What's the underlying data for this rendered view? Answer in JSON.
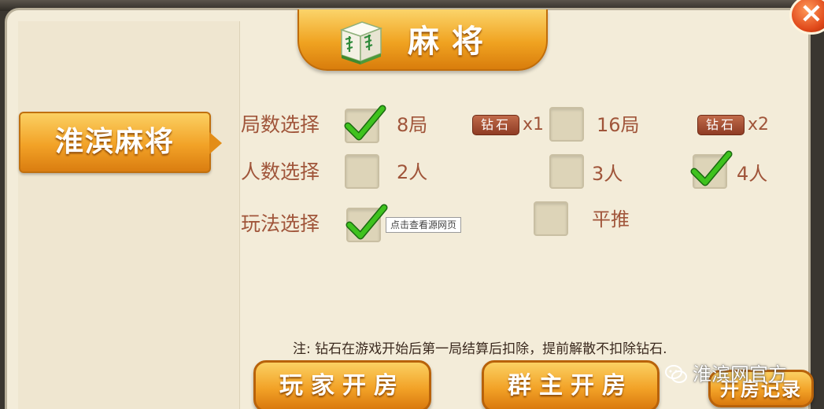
{
  "header": {
    "title": "麻将"
  },
  "sidebar": {
    "game_tab": "淮滨麻将"
  },
  "rows": {
    "rounds": {
      "label": "局数选择",
      "options": [
        {
          "label": "8局",
          "checked": true,
          "cost_badge": "钻石",
          "cost_mult": "x1"
        },
        {
          "label": "16局",
          "checked": false,
          "cost_badge": "钻石",
          "cost_mult": "x2"
        }
      ]
    },
    "players": {
      "label": "人数选择",
      "options": [
        {
          "label": "2人",
          "checked": false
        },
        {
          "label": "3人",
          "checked": false
        },
        {
          "label": "4人",
          "checked": true
        }
      ]
    },
    "rules": {
      "label": "玩法选择",
      "options": [
        {
          "label": "",
          "checked": true
        },
        {
          "label": "平推",
          "checked": false
        }
      ]
    }
  },
  "tooltip": "点击查看源网页",
  "note": "注: 钻石在游戏开始后第一局结算后扣除，提前解散不扣除钻石.",
  "buttons": {
    "player_room": "玩家开房",
    "group_room": "群主开房",
    "room_records": "开房记录"
  },
  "watermark": "淮滨网官方",
  "colors": {
    "accent_orange": "#f2a227",
    "label_brown": "#a0553a",
    "panel_cream": "#f3ecd9",
    "check_green": "#3fc21e"
  }
}
